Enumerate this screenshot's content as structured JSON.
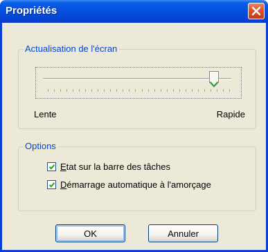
{
  "window": {
    "title": "Propriétés"
  },
  "screen_refresh": {
    "group_label": "Actualisation de l'écran",
    "min_label": "Lente",
    "max_label": "Rapide",
    "slider_value": 0.93
  },
  "options": {
    "group_label": "Options",
    "items": [
      {
        "mnemonic": "E",
        "rest": "tat sur la barre des tâches",
        "checked": true
      },
      {
        "mnemonic": "D",
        "rest": "émarrage automatique à l'amorçage",
        "checked": true
      }
    ]
  },
  "buttons": {
    "ok": "OK",
    "cancel": "Annuler"
  }
}
